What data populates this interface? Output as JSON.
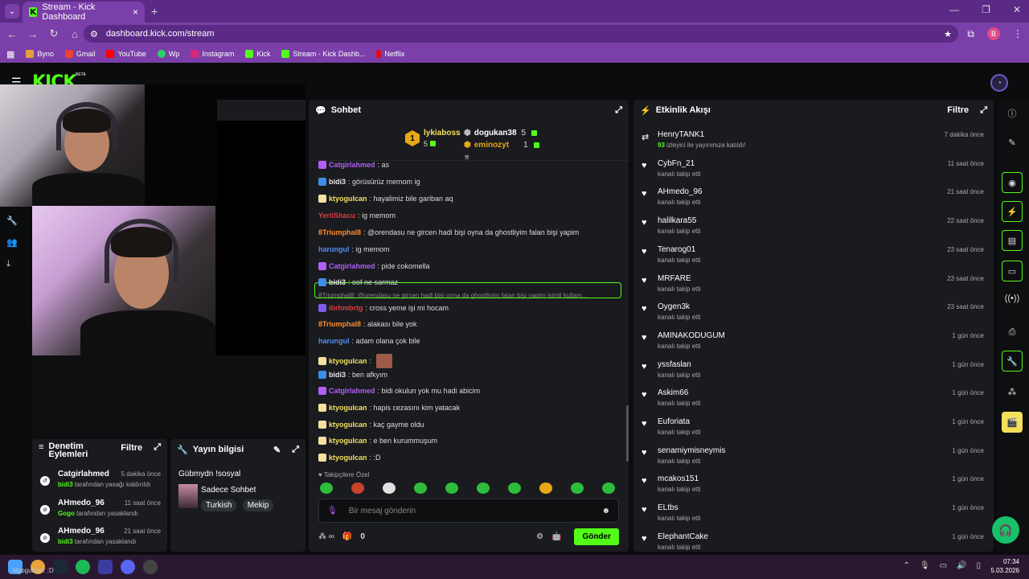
{
  "browser": {
    "tab_title": "Stream - Kick Dashboard",
    "url": "dashboard.kick.com/stream",
    "profile_initial": "B",
    "bookmarks": [
      "Byno",
      "Gmail",
      "YouTube",
      "Wp",
      "Instagram",
      "Kick",
      "Stream - Kick Dashb...",
      "Netflix"
    ]
  },
  "kick": {
    "logo": "KICK",
    "beta": "BETA"
  },
  "chat": {
    "title": "Sohbet",
    "pinned": {
      "top_rank": "1",
      "top_user": "lykiaboss",
      "top_count": "5",
      "second_user": "dogukan38",
      "second_count": "5",
      "third_user": "eminozyt",
      "third_count": "1"
    },
    "messages": [
      {
        "user": "Catgirlahmed",
        "text": ": as",
        "color": "#b25ef7"
      },
      {
        "user": "bidi3",
        "text": ": görüsürüz memom ig",
        "color": "#e6e6e6"
      },
      {
        "user": "ktyogulcan",
        "text": ": hayalimiz bile gariban aq",
        "color": "#f5e05c"
      },
      {
        "user": "YeriiShacu",
        "text": ": ig memom",
        "color": "#e0383e"
      },
      {
        "user": "8Triumphal8",
        "text": ": @orendasu ne gircen hadi bişi oyna da ghostliyim falan bişi yapim",
        "color": "#ff8a2a"
      },
      {
        "user": "harungul",
        "text": ": ig memom",
        "color": "#4f8ff7"
      },
      {
        "user": "Catgirlahmed",
        "text": ": pide cokomella",
        "color": "#b25ef7"
      },
      {
        "user": "bidi3",
        "text": ": oof ne sarmaz",
        "color": "#e6e6e6"
      },
      {
        "user": "ibrhmbrtg",
        "text": ": cross yeme işi mi hocam",
        "color": "#e0383e"
      },
      {
        "user": "8Triumphal8",
        "text": ": alakası bile yok",
        "color": "#ff8a2a"
      },
      {
        "user": "harungul",
        "text": ": adam olana çok bile",
        "color": "#4f8ff7"
      },
      {
        "user": "ktyogulcan",
        "text": ":",
        "color": "#f5e05c"
      },
      {
        "user": "bidi3",
        "text": ": ben afkyım",
        "color": "#e6e6e6"
      },
      {
        "user": "Catgirlahmed",
        "text": ": bidi okulun yok mu hadi abicim",
        "color": "#b25ef7"
      },
      {
        "user": "ktyogulcan",
        "text": ": hapis cezasını kim yatacak",
        "color": "#f5e05c"
      },
      {
        "user": "ktyogulcan",
        "text": ": kaç gayme oldu",
        "color": "#f5e05c"
      },
      {
        "user": "ktyogulcan",
        "text": ": e ben kurummuşum",
        "color": "#f5e05c"
      },
      {
        "user": "ktyogulcan",
        "text": ": :D",
        "color": "#f5e05c"
      }
    ],
    "reply_preview": "8Triumphal8: @orendasu ne gircen hadi bişi oyna da ghostliyim falan bişi yapim isimli kullanı...",
    "emote_header": "Takipçilere Özel",
    "input_placeholder": "Bir mesaj gönderin",
    "footer_count": "0",
    "send_label": "Gönder"
  },
  "activity": {
    "title": "Etkinlik Akışı",
    "filter_label": "Filtre",
    "items": [
      {
        "name": "HenryTANK1",
        "sub_num": "93",
        "sub": " izleyici ile yayınınıza katıldı!",
        "time": "7 dakika önce",
        "icon": "raid-icon"
      },
      {
        "name": "CybFn_21",
        "sub": "kanalı takip etti",
        "time": "11 saat önce",
        "icon": "heart-icon"
      },
      {
        "name": "AHmedo_96",
        "sub": "kanalı takip etti",
        "time": "21 saat önce",
        "icon": "heart-icon"
      },
      {
        "name": "halilkara55",
        "sub": "kanalı takip etti",
        "time": "22 saat önce",
        "icon": "heart-icon"
      },
      {
        "name": "Tenarog01",
        "sub": "kanalı takip etti",
        "time": "23 saat önce",
        "icon": "heart-icon"
      },
      {
        "name": "MRFARE",
        "sub": "kanalı takip etti",
        "time": "23 saat önce",
        "icon": "heart-icon"
      },
      {
        "name": "Oygen3k",
        "sub": "kanalı takip etti",
        "time": "23 saat önce",
        "icon": "heart-icon"
      },
      {
        "name": "AMINAKODUGUM",
        "sub": "kanalı takip etti",
        "time": "1 gün önce",
        "icon": "heart-icon"
      },
      {
        "name": "yssfaslan",
        "sub": "kanalı takip etti",
        "time": "1 gün önce",
        "icon": "heart-icon"
      },
      {
        "name": "Askim66",
        "sub": "kanalı takip etti",
        "time": "1 gün önce",
        "icon": "heart-icon"
      },
      {
        "name": "Euforiata",
        "sub": "kanalı takip etti",
        "time": "1 gün önce",
        "icon": "heart-icon"
      },
      {
        "name": "senamiymisneymis",
        "sub": "kanalı takip etti",
        "time": "1 gün önce",
        "icon": "heart-icon"
      },
      {
        "name": "mcakos151",
        "sub": "kanalı takip etti",
        "time": "1 gün önce",
        "icon": "heart-icon"
      },
      {
        "name": "ELtbs",
        "sub": "kanalı takip etti",
        "time": "1 gün önce",
        "icon": "heart-icon"
      },
      {
        "name": "ElephantCake",
        "sub": "kanalı takip etti",
        "time": "1 gün önce",
        "icon": "heart-icon"
      }
    ]
  },
  "modlog": {
    "title_line1": "Denetim",
    "title_line2": "Eylemleri",
    "filter_label": "Filtre",
    "rows": [
      {
        "name": "Catgirlahmed",
        "time": "5 dakika önce",
        "actor": "bidi3",
        "action": " tarafından yasağı kaldırıldı"
      },
      {
        "name": "AHmedo_96",
        "time": "11 saat önce",
        "actor": "Gogo",
        "action": " tarafından yasaklandı"
      },
      {
        "name": "AHmedo_96",
        "time": "21 saat önce",
        "actor": "bidi3",
        "action": " tarafından yasaklandı"
      }
    ]
  },
  "info": {
    "title": "Yayın bilgisi",
    "stream_title": "Gübmydn !sosyal",
    "category": "Sadece Sohbet",
    "tags": [
      "Turkish",
      "Mekip"
    ]
  },
  "taskbar": {
    "time": "07:34",
    "date": "5.03.2026",
    "status_text": "ktyogulcan: :D"
  },
  "colors": {
    "accent": "#53fc18",
    "panel": "#191b1f",
    "browser": "#7a3fa8"
  }
}
